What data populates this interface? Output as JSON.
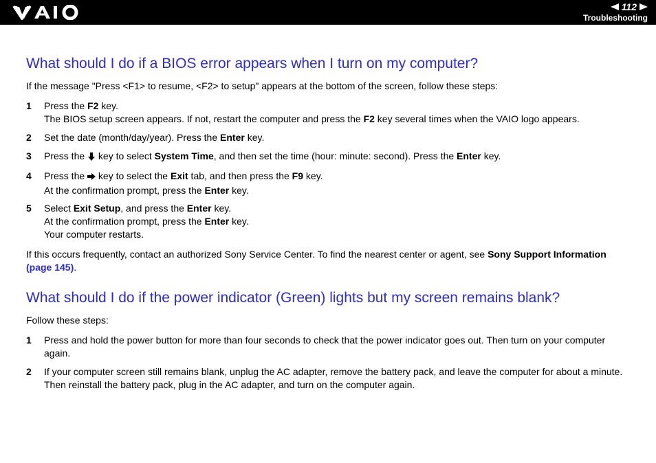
{
  "header": {
    "page_number": "112",
    "section": "Troubleshooting"
  },
  "section1": {
    "title": "What should I do if a BIOS error appears when I turn on my computer?",
    "intro": "If the message \"Press <F1> to resume, <F2> to setup\" appears at the bottom of the screen, follow these steps:",
    "steps": {
      "s1a": "Press the ",
      "s1b": "F2",
      "s1c": " key.",
      "s1d": "The BIOS setup screen appears. If not, restart the computer and press the ",
      "s1e": "F2",
      "s1f": " key several times when the VAIO logo appears.",
      "s2a": "Set the date (month/day/year). Press the ",
      "s2b": "Enter",
      "s2c": " key.",
      "s3a": "Press the ",
      "s3b": " key to select ",
      "s3c": "System Time",
      "s3d": ", and then set the time (hour: minute: second). Press the ",
      "s3e": "Enter",
      "s3f": " key.",
      "s4a": "Press the ",
      "s4b": " key to select the ",
      "s4c": "Exit",
      "s4d": " tab, and then press the ",
      "s4e": "F9",
      "s4f": " key.",
      "s4g": "At the confirmation prompt, press the ",
      "s4h": "Enter",
      "s4i": " key.",
      "s5a": "Select ",
      "s5b": "Exit Setup",
      "s5c": ", and press the ",
      "s5d": "Enter",
      "s5e": " key.",
      "s5f": "At the confirmation prompt, press the ",
      "s5g": "Enter",
      "s5h": " key.",
      "s5i": "Your computer restarts."
    },
    "after_a": "If this occurs frequently, contact an authorized Sony Service Center. To find the nearest center or agent, see ",
    "after_b": "Sony Support Information ",
    "after_link": "(page 145)",
    "after_c": "."
  },
  "section2": {
    "title": "What should I do if the power indicator (Green) lights but my screen remains blank?",
    "intro": "Follow these steps:",
    "steps": {
      "s1": "Press and hold the power button for more than four seconds to check that the power indicator goes out. Then turn on your computer again.",
      "s2": "If your computer screen still remains blank, unplug the AC adapter, remove the battery pack, and leave the computer for about a minute. Then reinstall the battery pack, plug in the AC adapter, and turn on the computer again."
    }
  }
}
